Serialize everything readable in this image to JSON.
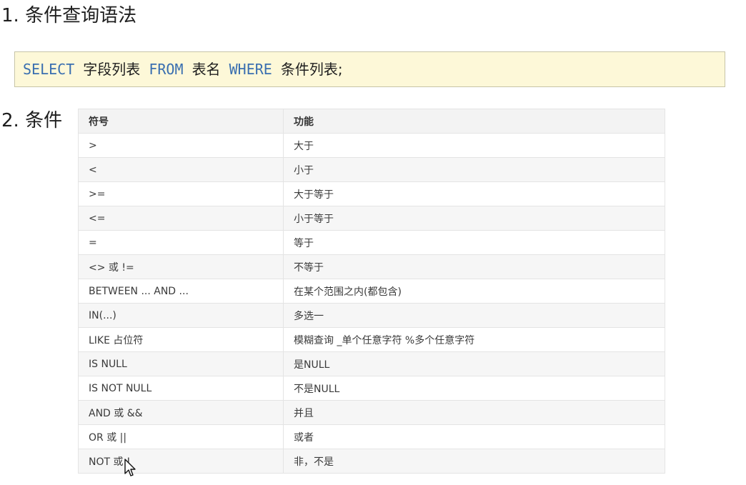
{
  "section1": {
    "title": "1. 条件查询语法"
  },
  "syntax": {
    "kw_select": "SELECT",
    "fields": "字段列表",
    "kw_from": "FROM",
    "table_name": "表名",
    "kw_where": "WHERE",
    "conditions": "条件列表;"
  },
  "section2": {
    "title": "2. 条件"
  },
  "table": {
    "headers": [
      "符号",
      "功能"
    ],
    "rows": [
      [
        ">",
        "大于"
      ],
      [
        "<",
        "小于"
      ],
      [
        ">=",
        "大于等于"
      ],
      [
        "<=",
        "小于等于"
      ],
      [
        "=",
        "等于"
      ],
      [
        "<> 或 !=",
        "不等于"
      ],
      [
        "BETWEEN ... AND ...",
        "在某个范围之内(都包含)"
      ],
      [
        "IN(...)",
        "多选一"
      ],
      [
        "LIKE 占位符",
        "模糊查询 _单个任意字符 %多个任意字符"
      ],
      [
        "IS NULL",
        "是NULL"
      ],
      [
        "IS NOT NULL",
        "不是NULL"
      ],
      [
        "AND 或 &&",
        "并且"
      ],
      [
        "OR 或 ||",
        "或者"
      ],
      [
        "NOT 或 !",
        "非，不是"
      ]
    ]
  },
  "colors": {
    "keyword": "#3a6fb0",
    "code_background": "#fdf8d8",
    "header_background": "#f3f3f3"
  }
}
